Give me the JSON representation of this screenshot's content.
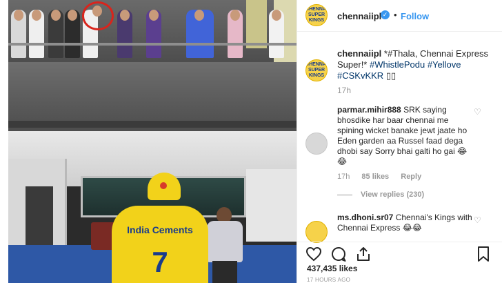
{
  "post": {
    "username": "chennaiipl",
    "verified_icon": "verified-badge-icon",
    "separator": "•",
    "follow_label": "Follow",
    "avatar_text": "CHENNAI SUPER KINGS"
  },
  "caption": {
    "username": "chennaiipl",
    "text": "*#Thala, Chennai Express Super!*",
    "hashtags": "#WhistlePodu #Yellove #CSKvKKR",
    "emoji": "▯▯",
    "time": "17h"
  },
  "comments": [
    {
      "username": "parmar.mihir888",
      "text": "SRK saying bhosdike har baar chennai me spining wicket banake jewt jaate ho Eden garden aa Russel faad dega dhobi say Sorry bhai galti ho gai 😂😂",
      "time": "17h",
      "likes": "85 likes",
      "reply": "Reply",
      "view_replies": "View replies (230)"
    },
    {
      "username": "ms.dhoni.sr07",
      "text": "Chennai's Kings with Chennai Express 😂😂"
    }
  ],
  "footer": {
    "likes": "437,435 likes",
    "posted": "17 HOURS AGO"
  },
  "photo": {
    "jersey_text": "India Cements",
    "jersey_number": "7"
  },
  "colors": {
    "link_blue": "#3897f0",
    "csk_yellow": "#f2d21a",
    "highlight_circle": "#d9241c"
  }
}
